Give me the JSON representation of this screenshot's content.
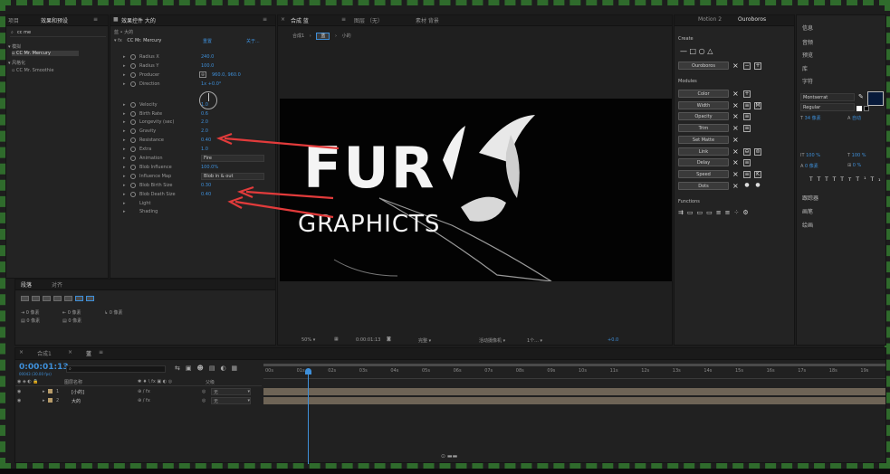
{
  "project": {
    "tab_project": "项目",
    "tab_effects": "效果和预设",
    "search": "cc me",
    "tree": [
      {
        "label": "模拟"
      },
      {
        "label": "CC Mr. Mercury",
        "selected": true
      },
      {
        "label": "风格化"
      },
      {
        "label": "CC Mr. Smoothie"
      }
    ]
  },
  "effects": {
    "tab": "效果控件 大的",
    "comp_label": "蓝 • 大的",
    "fx_name": "CC Mr. Mercury",
    "reset": "重置",
    "about": "关于...",
    "properties": [
      {
        "name": "Radius X",
        "value": "240.0"
      },
      {
        "name": "Radius Y",
        "value": "100.0"
      },
      {
        "name": "Producer",
        "value": "960.0, 960.0"
      },
      {
        "name": "Direction",
        "value": "1x +0.0°"
      },
      {
        "name": "Velocity",
        "value": "1.0"
      },
      {
        "name": "Birth Rate",
        "value": "0.6"
      },
      {
        "name": "Longevity (sec)",
        "value": "2.0"
      },
      {
        "name": "Gravity",
        "value": "2.0"
      },
      {
        "name": "Resistance",
        "value": "0.40"
      },
      {
        "name": "Extra",
        "value": "1.0"
      },
      {
        "name": "Animation",
        "value": "Fire"
      },
      {
        "name": "Blob Influence",
        "value": "100.0%"
      },
      {
        "name": "Influence Map",
        "value": "Blob in & out"
      },
      {
        "name": "Blob Birth Size",
        "value": "0.30"
      },
      {
        "name": "Blob Death Size",
        "value": "0.40"
      },
      {
        "name": "Light",
        "value": ""
      },
      {
        "name": "Shading",
        "value": ""
      }
    ]
  },
  "align": {
    "tab_align": "段落",
    "tab_other": "对齐",
    "vals": [
      "0 像素",
      "0 像素",
      "0 像素",
      "0 像素",
      "0 像素"
    ]
  },
  "composition": {
    "tab": "合成 蓝",
    "layer_tab": "图层 （无）",
    "footage_tab": "素材 背景",
    "crumbs": [
      "合成1",
      "蓝",
      "小的"
    ],
    "canvas_text_top": "FUR",
    "canvas_text_bottom": "GRAPHICTS",
    "zoom": "50%",
    "timecode": "0:00:01:13",
    "quality": "完整",
    "camera": "活动摄像机",
    "views": "1个...",
    "exposure": "+0.0"
  },
  "motion": {
    "tab_motion": "Motion 2",
    "tab_ouroboros": "Ouroboros",
    "create_label": "Create",
    "ouroboros_btn": "Ouroboros",
    "modules_label": "Modules",
    "modules": [
      "Color",
      "Width",
      "Opacity",
      "Trim",
      "Set Matte",
      "Link",
      "Delay",
      "Speed",
      "Dots"
    ],
    "functions_label": "Functions"
  },
  "right": {
    "items": [
      "信息",
      "音频",
      "预览",
      "库",
      "字符"
    ],
    "font": "Montserrat",
    "style": "Regular",
    "size": "34 像素",
    "leading": "自动",
    "scale_v": "100 %",
    "scale_h": "100 %",
    "baseline": "0 像素",
    "tsume": "0 %",
    "lower": [
      "跟踪器",
      "画笔",
      "绘画"
    ]
  },
  "timeline": {
    "tab_comp1": "合成1",
    "tab_blue": "蓝",
    "timecode": "0:00:01:13",
    "fps": "00043 (30.00 fps)",
    "col_name": "图层名称",
    "col_parent": "父级",
    "layers": [
      {
        "num": "1",
        "name": "[小的]",
        "parent": "无"
      },
      {
        "num": "2",
        "name": "大的",
        "parent": "无"
      }
    ],
    "ruler": [
      "00s",
      "01s",
      "02s",
      "03s",
      "04s",
      "05s",
      "06s",
      "07s",
      "08s",
      "09s",
      "10s",
      "11s",
      "12s",
      "13s",
      "14s",
      "15s",
      "16s",
      "17s",
      "18s",
      "19s"
    ]
  },
  "accent": "#3e8fd9",
  "arrow_color": "#e23b3b"
}
